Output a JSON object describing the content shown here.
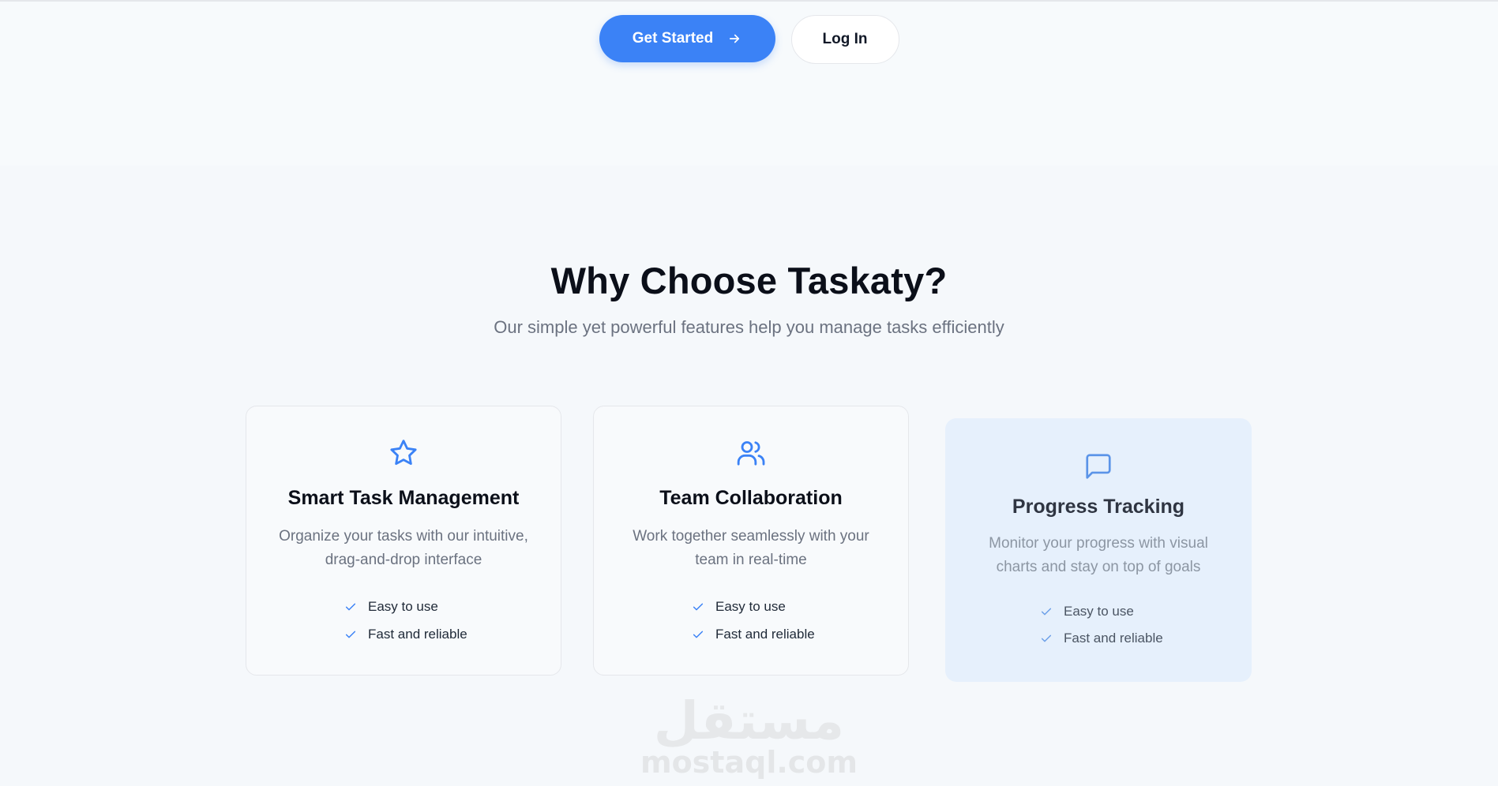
{
  "hero": {
    "get_started_label": "Get Started",
    "login_label": "Log In"
  },
  "features": {
    "title": "Why Choose Taskaty?",
    "subtitle": "Our simple yet powerful features help you manage tasks efficiently",
    "cards": [
      {
        "icon": "star-icon",
        "title": "Smart Task Management",
        "description": "Organize your tasks with our intuitive, drag-and-drop interface",
        "points": [
          "Easy to use",
          "Fast and reliable"
        ]
      },
      {
        "icon": "users-icon",
        "title": "Team Collaboration",
        "description": "Work together seamlessly with your team in real-time",
        "points": [
          "Easy to use",
          "Fast and reliable"
        ]
      },
      {
        "icon": "message-square-icon",
        "title": "Progress Tracking",
        "description": "Monitor your progress with visual charts and stay on top of goals",
        "points": [
          "Easy to use",
          "Fast and reliable"
        ]
      }
    ]
  },
  "watermark": {
    "arabic": "مستقل",
    "latin": "mostaql.com"
  },
  "colors": {
    "accent": "#3b82f6",
    "background": "#f7fafc",
    "highlight_card": "#e6f0fc",
    "heading": "#0b0f19",
    "muted_text": "#6b7280"
  }
}
